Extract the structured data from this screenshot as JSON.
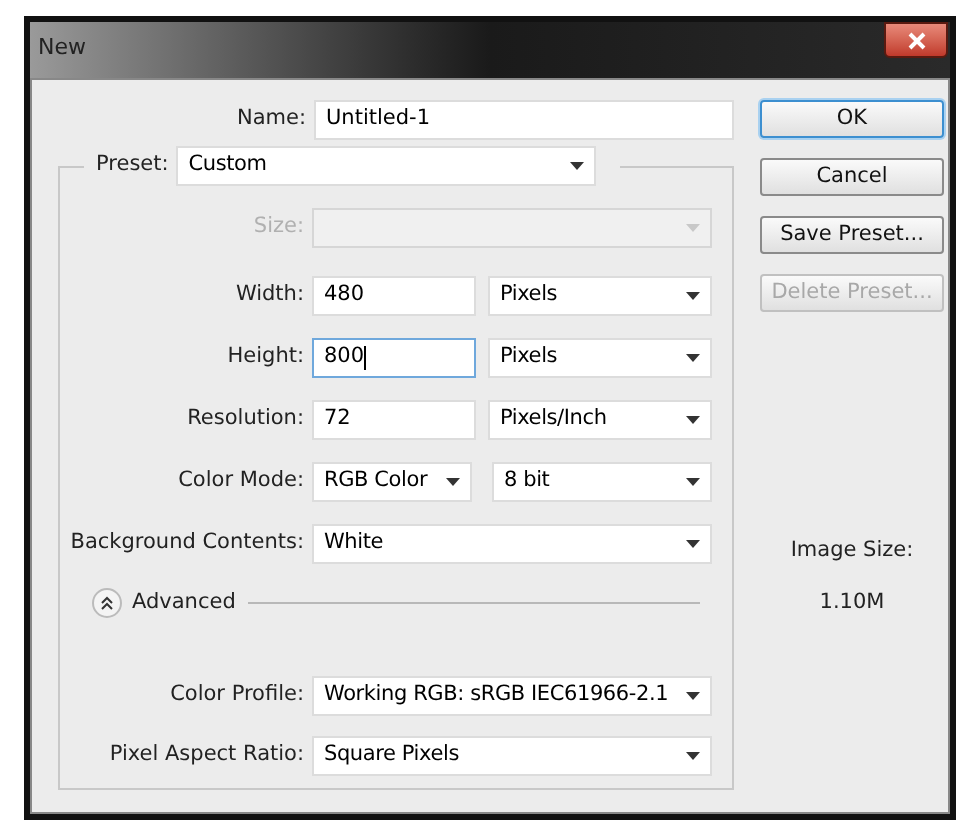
{
  "window": {
    "title": "New"
  },
  "name": {
    "label": "Name:",
    "value": "Untitled-1"
  },
  "preset": {
    "label": "Preset:",
    "value": "Custom"
  },
  "rows": [
    {
      "label": "Size:",
      "kind": "select",
      "value": "",
      "disabled": true
    },
    {
      "label": "Width:",
      "kind": "input_unit",
      "value": "480",
      "unit": "Pixels",
      "focused": false
    },
    {
      "label": "Height:",
      "kind": "input_unit",
      "value": "800",
      "unit": "Pixels",
      "focused": true
    },
    {
      "label": "Resolution:",
      "kind": "input_unit",
      "value": "72",
      "unit": "Pixels/Inch",
      "focused": false
    },
    {
      "label": "Color Mode:",
      "kind": "double_select",
      "value": "RGB Color",
      "unit": "8 bit"
    },
    {
      "label": "Background Contents:",
      "kind": "select",
      "value": "White",
      "disabled": false
    }
  ],
  "advanced": {
    "label": "Advanced",
    "expanded": true
  },
  "advanced_rows": [
    {
      "label": "Color Profile:",
      "kind": "select",
      "value": "Working RGB:  sRGB IEC61966-2.1",
      "disabled": false
    },
    {
      "label": "Pixel Aspect Ratio:",
      "kind": "select",
      "value": "Square Pixels",
      "disabled": false
    }
  ],
  "buttons": [
    {
      "label": "OK",
      "default": true,
      "disabled": false
    },
    {
      "label": "Cancel",
      "default": false,
      "disabled": false
    },
    {
      "label": "Save Preset...",
      "default": false,
      "disabled": false
    },
    {
      "label": "Delete Preset...",
      "default": false,
      "disabled": true
    }
  ],
  "image_size": {
    "label": "Image Size:",
    "value": "1.10M"
  }
}
